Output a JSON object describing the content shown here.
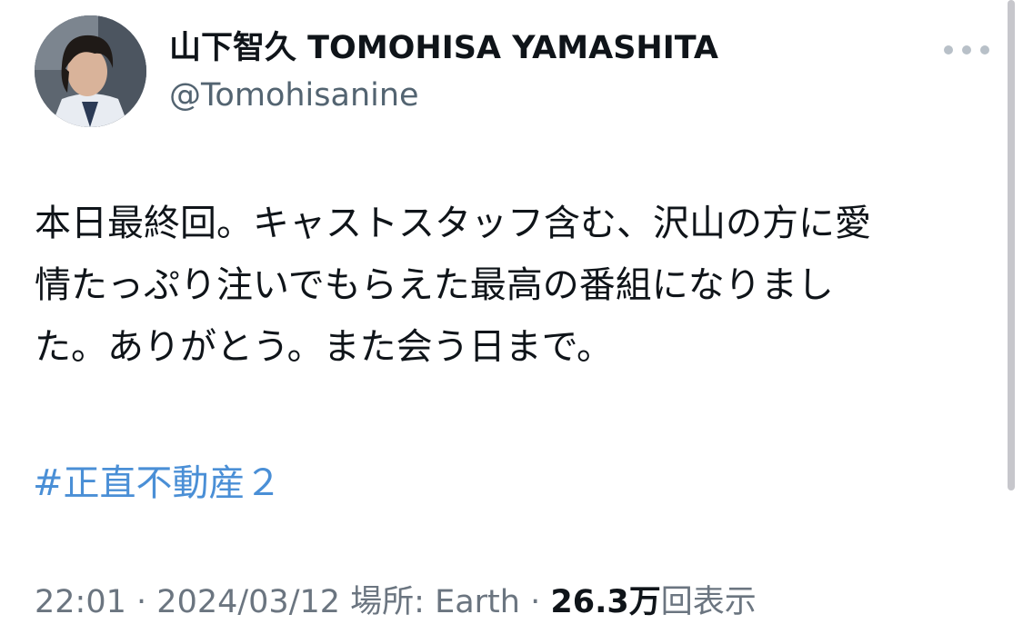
{
  "author": {
    "display_name": "山下智久 TOMOHISA YAMASHITA",
    "handle": "@Tomohisanine"
  },
  "tweet": {
    "lines": [
      "本日最終回。キャストスタッフ含む、沢山の方に愛",
      "情たっぷり注いでもらえた最高の番組になりまし",
      "た。ありがとう。また会う日まで。"
    ],
    "hashtag": "#正直不動産２"
  },
  "meta": {
    "time": "22:01",
    "date": "2024/03/12",
    "location_label": "場所: Earth",
    "separator": "·",
    "views_count": "26.3万",
    "views_label": "回表示"
  },
  "icons": {
    "more": "more-horizontal-icon"
  },
  "colors": {
    "text": "#0f1419",
    "secondary": "#536471",
    "hashtag": "#4a8fd6",
    "meta": "#6b7580"
  }
}
